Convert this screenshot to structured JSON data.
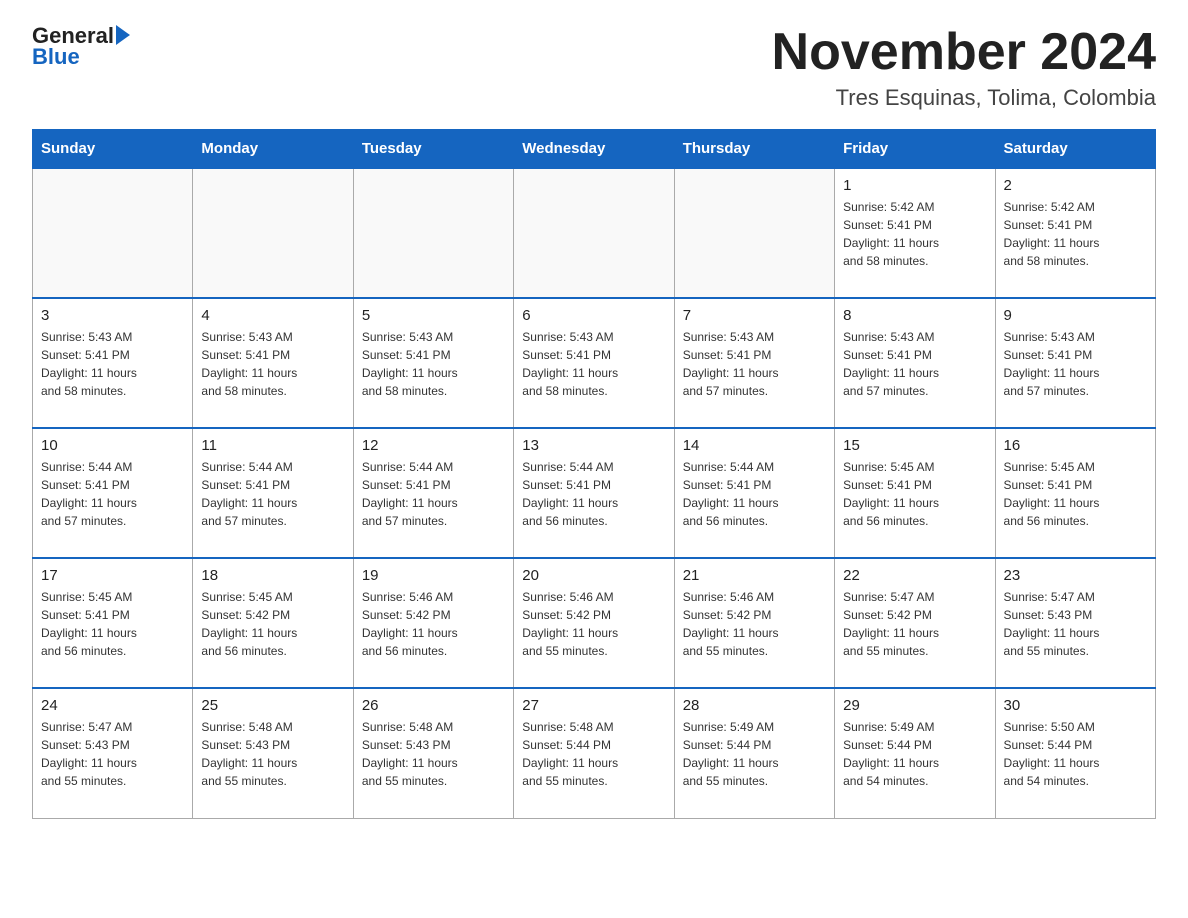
{
  "logo": {
    "part1": "General",
    "part2": "Blue"
  },
  "header": {
    "month_title": "November 2024",
    "location": "Tres Esquinas, Tolima, Colombia"
  },
  "days_of_week": [
    "Sunday",
    "Monday",
    "Tuesday",
    "Wednesday",
    "Thursday",
    "Friday",
    "Saturday"
  ],
  "weeks": [
    [
      {
        "day": "",
        "info": ""
      },
      {
        "day": "",
        "info": ""
      },
      {
        "day": "",
        "info": ""
      },
      {
        "day": "",
        "info": ""
      },
      {
        "day": "",
        "info": ""
      },
      {
        "day": "1",
        "info": "Sunrise: 5:42 AM\nSunset: 5:41 PM\nDaylight: 11 hours\nand 58 minutes."
      },
      {
        "day": "2",
        "info": "Sunrise: 5:42 AM\nSunset: 5:41 PM\nDaylight: 11 hours\nand 58 minutes."
      }
    ],
    [
      {
        "day": "3",
        "info": "Sunrise: 5:43 AM\nSunset: 5:41 PM\nDaylight: 11 hours\nand 58 minutes."
      },
      {
        "day": "4",
        "info": "Sunrise: 5:43 AM\nSunset: 5:41 PM\nDaylight: 11 hours\nand 58 minutes."
      },
      {
        "day": "5",
        "info": "Sunrise: 5:43 AM\nSunset: 5:41 PM\nDaylight: 11 hours\nand 58 minutes."
      },
      {
        "day": "6",
        "info": "Sunrise: 5:43 AM\nSunset: 5:41 PM\nDaylight: 11 hours\nand 58 minutes."
      },
      {
        "day": "7",
        "info": "Sunrise: 5:43 AM\nSunset: 5:41 PM\nDaylight: 11 hours\nand 57 minutes."
      },
      {
        "day": "8",
        "info": "Sunrise: 5:43 AM\nSunset: 5:41 PM\nDaylight: 11 hours\nand 57 minutes."
      },
      {
        "day": "9",
        "info": "Sunrise: 5:43 AM\nSunset: 5:41 PM\nDaylight: 11 hours\nand 57 minutes."
      }
    ],
    [
      {
        "day": "10",
        "info": "Sunrise: 5:44 AM\nSunset: 5:41 PM\nDaylight: 11 hours\nand 57 minutes."
      },
      {
        "day": "11",
        "info": "Sunrise: 5:44 AM\nSunset: 5:41 PM\nDaylight: 11 hours\nand 57 minutes."
      },
      {
        "day": "12",
        "info": "Sunrise: 5:44 AM\nSunset: 5:41 PM\nDaylight: 11 hours\nand 57 minutes."
      },
      {
        "day": "13",
        "info": "Sunrise: 5:44 AM\nSunset: 5:41 PM\nDaylight: 11 hours\nand 56 minutes."
      },
      {
        "day": "14",
        "info": "Sunrise: 5:44 AM\nSunset: 5:41 PM\nDaylight: 11 hours\nand 56 minutes."
      },
      {
        "day": "15",
        "info": "Sunrise: 5:45 AM\nSunset: 5:41 PM\nDaylight: 11 hours\nand 56 minutes."
      },
      {
        "day": "16",
        "info": "Sunrise: 5:45 AM\nSunset: 5:41 PM\nDaylight: 11 hours\nand 56 minutes."
      }
    ],
    [
      {
        "day": "17",
        "info": "Sunrise: 5:45 AM\nSunset: 5:41 PM\nDaylight: 11 hours\nand 56 minutes."
      },
      {
        "day": "18",
        "info": "Sunrise: 5:45 AM\nSunset: 5:42 PM\nDaylight: 11 hours\nand 56 minutes."
      },
      {
        "day": "19",
        "info": "Sunrise: 5:46 AM\nSunset: 5:42 PM\nDaylight: 11 hours\nand 56 minutes."
      },
      {
        "day": "20",
        "info": "Sunrise: 5:46 AM\nSunset: 5:42 PM\nDaylight: 11 hours\nand 55 minutes."
      },
      {
        "day": "21",
        "info": "Sunrise: 5:46 AM\nSunset: 5:42 PM\nDaylight: 11 hours\nand 55 minutes."
      },
      {
        "day": "22",
        "info": "Sunrise: 5:47 AM\nSunset: 5:42 PM\nDaylight: 11 hours\nand 55 minutes."
      },
      {
        "day": "23",
        "info": "Sunrise: 5:47 AM\nSunset: 5:43 PM\nDaylight: 11 hours\nand 55 minutes."
      }
    ],
    [
      {
        "day": "24",
        "info": "Sunrise: 5:47 AM\nSunset: 5:43 PM\nDaylight: 11 hours\nand 55 minutes."
      },
      {
        "day": "25",
        "info": "Sunrise: 5:48 AM\nSunset: 5:43 PM\nDaylight: 11 hours\nand 55 minutes."
      },
      {
        "day": "26",
        "info": "Sunrise: 5:48 AM\nSunset: 5:43 PM\nDaylight: 11 hours\nand 55 minutes."
      },
      {
        "day": "27",
        "info": "Sunrise: 5:48 AM\nSunset: 5:44 PM\nDaylight: 11 hours\nand 55 minutes."
      },
      {
        "day": "28",
        "info": "Sunrise: 5:49 AM\nSunset: 5:44 PM\nDaylight: 11 hours\nand 55 minutes."
      },
      {
        "day": "29",
        "info": "Sunrise: 5:49 AM\nSunset: 5:44 PM\nDaylight: 11 hours\nand 54 minutes."
      },
      {
        "day": "30",
        "info": "Sunrise: 5:50 AM\nSunset: 5:44 PM\nDaylight: 11 hours\nand 54 minutes."
      }
    ]
  ]
}
